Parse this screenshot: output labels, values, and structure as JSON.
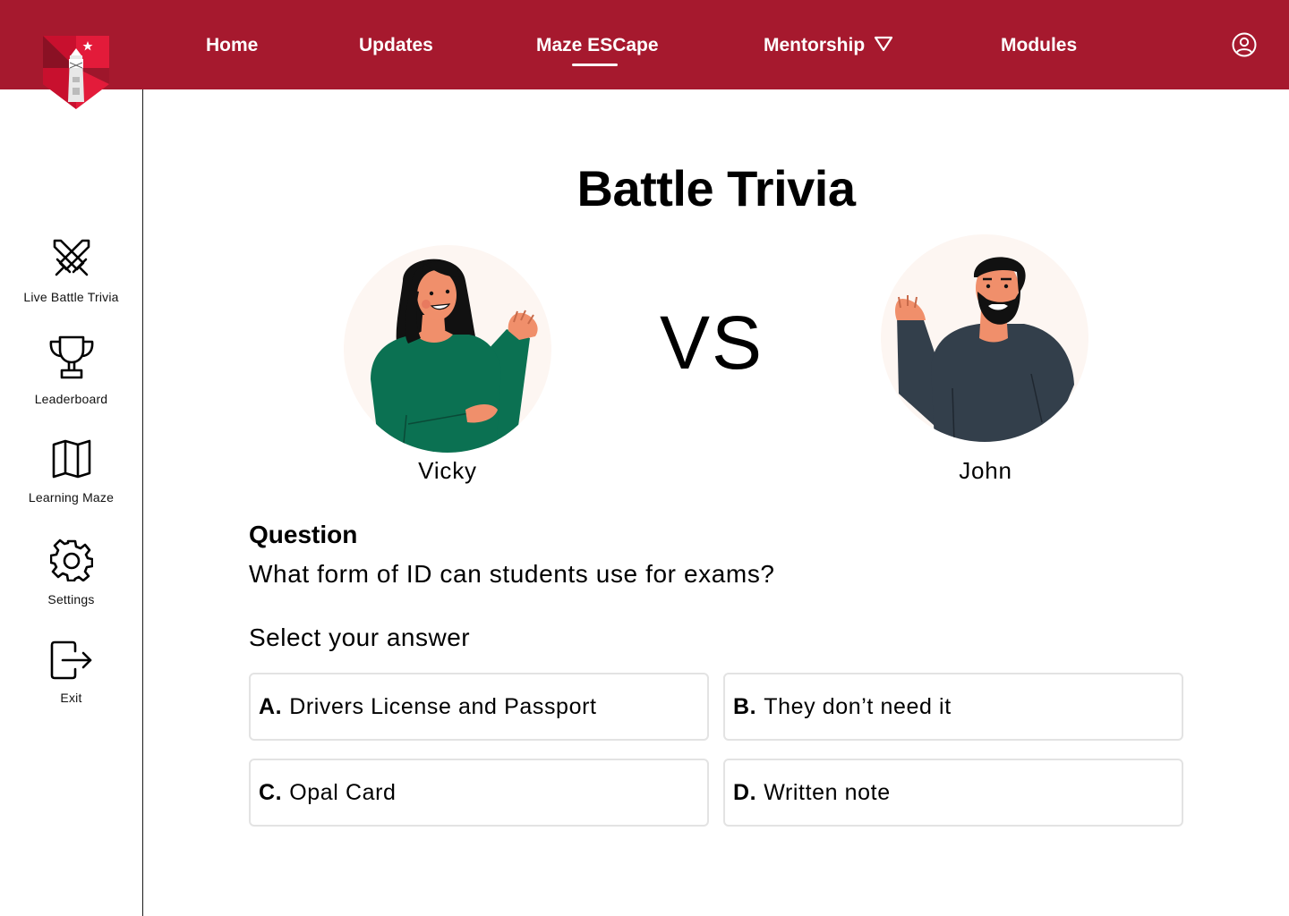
{
  "nav": {
    "items": [
      "Home",
      "Updates",
      "Maze ESCape",
      "Mentorship",
      "Modules"
    ],
    "active": "Maze ESCape",
    "brand_color": "#a6192e"
  },
  "sidebar": {
    "items": [
      {
        "label": "Live Battle Trivia",
        "icon": "crossed-swords-icon"
      },
      {
        "label": "Leaderboard",
        "icon": "trophy-icon"
      },
      {
        "label": "Learning Maze",
        "icon": "map-icon"
      },
      {
        "label": "Settings",
        "icon": "gear-icon"
      },
      {
        "label": "Exit",
        "icon": "exit-icon"
      }
    ]
  },
  "game": {
    "title": "Battle Trivia",
    "vs_label": "VS",
    "players": [
      {
        "name": "Vicky"
      },
      {
        "name": "John"
      }
    ]
  },
  "question": {
    "heading": "Question",
    "text": "What form of ID can students use for exams?",
    "prompt": "Select your answer",
    "options": [
      {
        "letter": "A.",
        "text": "Drivers License and Passport"
      },
      {
        "letter": "B.",
        "text": "They don’t need it"
      },
      {
        "letter": "C.",
        "text": "Opal Card"
      },
      {
        "letter": "D.",
        "text": "Written note"
      }
    ]
  }
}
